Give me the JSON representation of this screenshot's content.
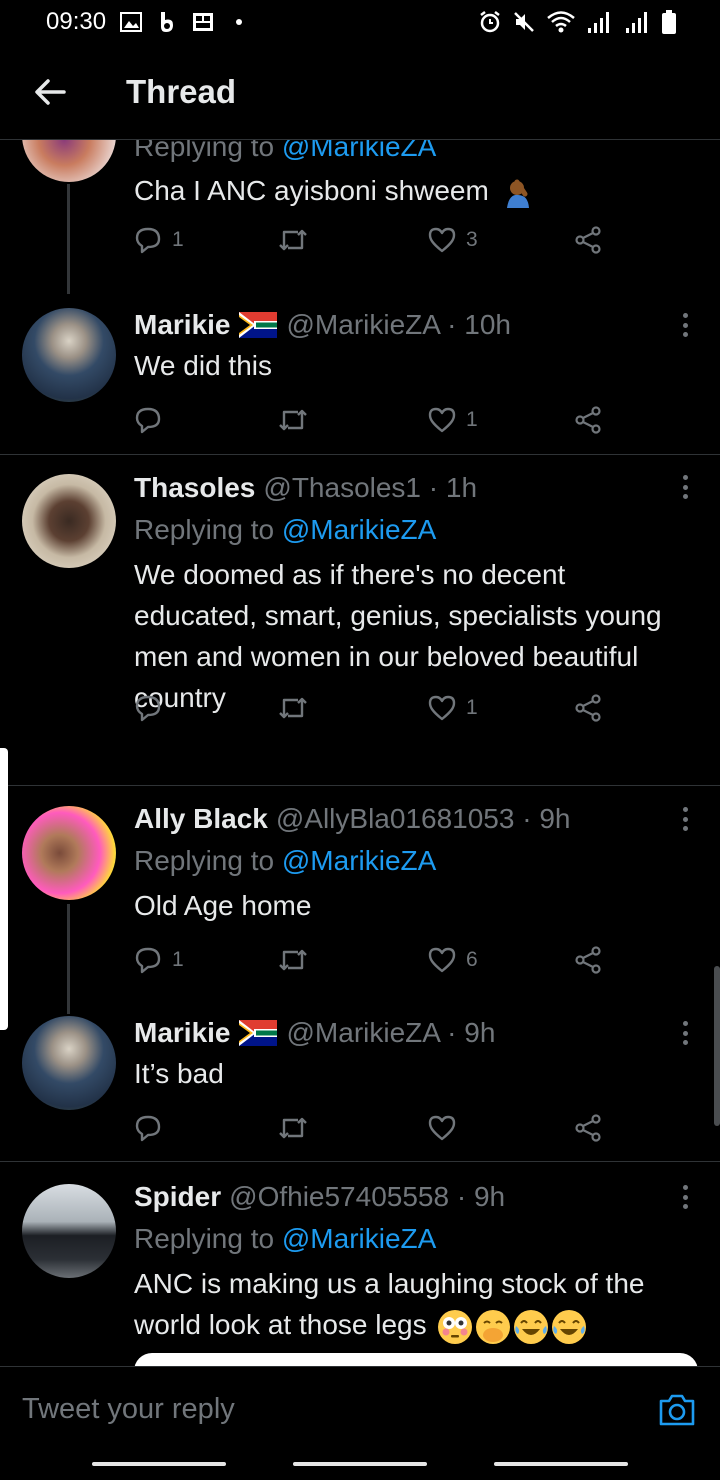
{
  "status": {
    "time": "09:30"
  },
  "header": {
    "title": "Thread"
  },
  "tweets": [
    {
      "name": "",
      "handle": "",
      "replying_prefix": "Replying to ",
      "replying_to": "@MarikieZA",
      "text": "Cha I ANC ayisboni shweem",
      "replies": "1",
      "retweets": "",
      "likes": "3"
    },
    {
      "name": "Marikie",
      "handle": "@MarikieZA · 10h",
      "text": "We did this",
      "replies": "",
      "retweets": "",
      "likes": "1"
    },
    {
      "name": "Thasoles",
      "handle": "@Thasoles1 · 1h",
      "replying_prefix": "Replying to ",
      "replying_to": "@MarikieZA",
      "text": "We doomed as if there's no decent educated, smart, genius, specialists young men and women in our beloved beautiful country",
      "replies": "",
      "retweets": "",
      "likes": "1"
    },
    {
      "name": "Ally Black",
      "handle": "@AllyBla01681053 · 9h",
      "replying_prefix": "Replying to ",
      "replying_to": "@MarikieZA",
      "text": "Old Age home",
      "replies": "1",
      "retweets": "",
      "likes": "6"
    },
    {
      "name": "Marikie",
      "handle": "@MarikieZA · 9h",
      "text": "It’s bad",
      "replies": "",
      "retweets": "",
      "likes": ""
    },
    {
      "name": "Spider",
      "handle": "@Ofhie57405558 · 9h",
      "replying_prefix": "Replying to ",
      "replying_to": "@MarikieZA",
      "text": "ANC is making us a laughing stock of the world look at those legs"
    }
  ],
  "composer": {
    "placeholder": "Tweet your reply"
  },
  "colors": {
    "accent": "#1d9bf0",
    "muted": "#71767b",
    "background": "#000000"
  }
}
